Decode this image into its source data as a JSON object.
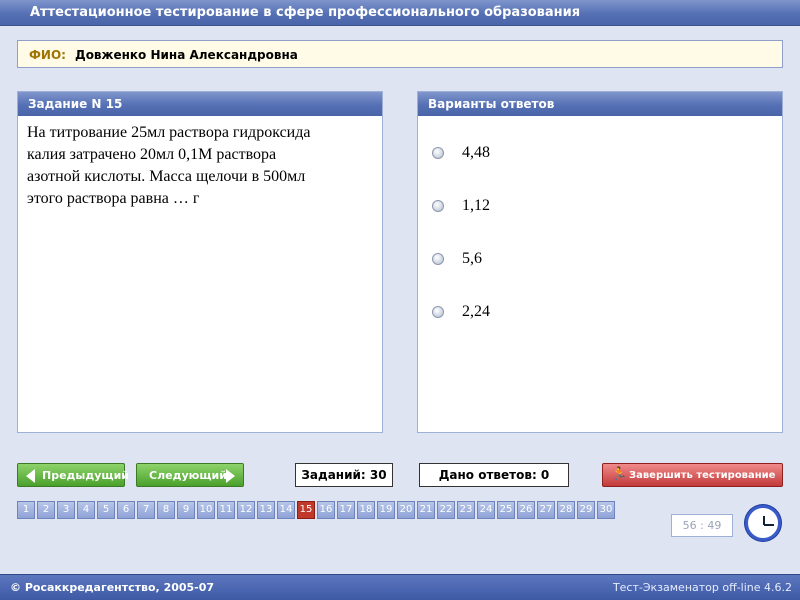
{
  "window": {
    "title": "Аттестационное тестирование в сфере профессионального образования"
  },
  "fio": {
    "label": "ФИО:",
    "value": "Довженко Нина Александровна"
  },
  "task": {
    "header": "Задание N 15",
    "question_lines": [
      "На титрование 25мл раствора гидроксида",
      "калия затрачено 20мл 0,1М раствора",
      "азотной кислоты. Масса щелочи в 500мл",
      "этого раствора равна … г"
    ]
  },
  "answers": {
    "header": "Варианты ответов",
    "options": [
      "4,48",
      "1,12",
      "5,6",
      "2,24"
    ]
  },
  "controls": {
    "prev_label": "Предыдущий",
    "next_label": "Следующий",
    "tasks_count": "Заданий: 30",
    "answers_given": "Дано ответов: 0",
    "finish_label": "Завершить тестирование"
  },
  "question_numbers": [
    "1",
    "2",
    "3",
    "4",
    "5",
    "6",
    "7",
    "8",
    "9",
    "10",
    "11",
    "12",
    "13",
    "14",
    "15",
    "16",
    "17",
    "18",
    "19",
    "20",
    "21",
    "22",
    "23",
    "24",
    "25",
    "26",
    "27",
    "28",
    "29",
    "30"
  ],
  "current_question": "15",
  "timer": "56 : 49",
  "footer": {
    "left": "© Росаккредагентство, 2005-07",
    "right": "Тест-Экзаменатор off-line 4.6.2"
  },
  "icons": {
    "finish": "running-man-icon",
    "clock": "clock-icon"
  },
  "colors": {
    "accent": "#5570b4",
    "next_button": "#4aa12c",
    "finish_button": "#c23a3a",
    "active_number": "#c0392b"
  }
}
